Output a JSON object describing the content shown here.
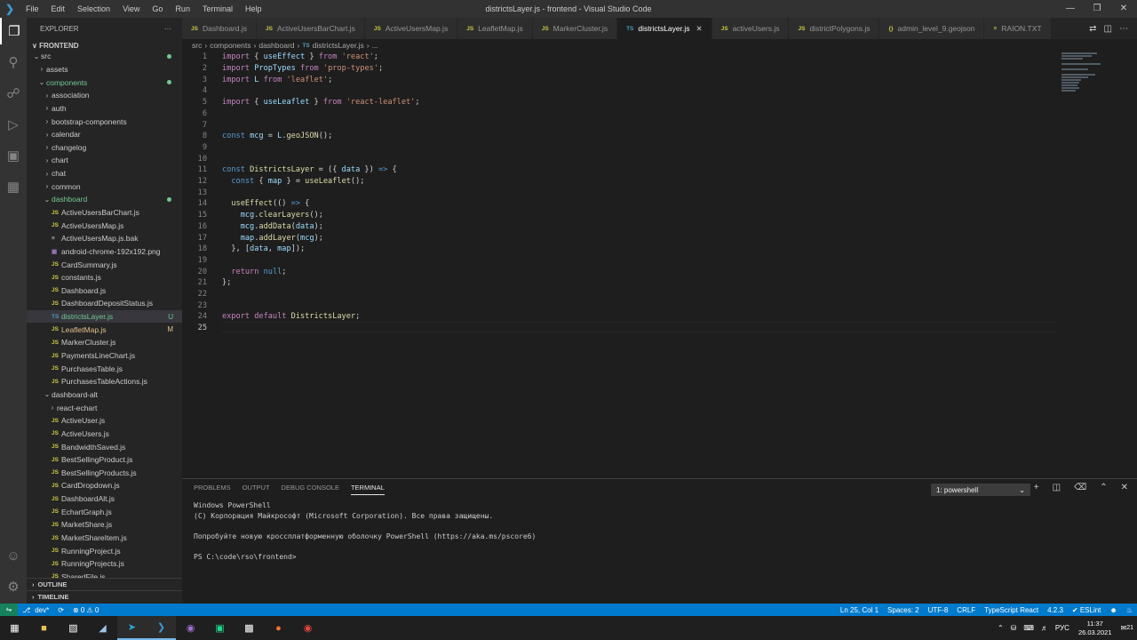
{
  "window": {
    "title": "districtsLayer.js - frontend - Visual Studio Code",
    "menus": [
      "File",
      "Edit",
      "Selection",
      "View",
      "Go",
      "Run",
      "Terminal",
      "Help"
    ]
  },
  "sidebar": {
    "header": "EXPLORER",
    "more": "···",
    "root": "FRONTEND",
    "items": [
      {
        "label": "src",
        "kind": "folder-open",
        "indent": 1,
        "status": "dot"
      },
      {
        "label": "assets",
        "kind": "folder",
        "indent": 2,
        "status": ""
      },
      {
        "label": "components",
        "kind": "folder-open",
        "indent": 2,
        "status": "dot",
        "color": "green"
      },
      {
        "label": "association",
        "kind": "folder",
        "indent": 3,
        "status": ""
      },
      {
        "label": "auth",
        "kind": "folder",
        "indent": 3,
        "status": ""
      },
      {
        "label": "bootstrap-components",
        "kind": "folder",
        "indent": 3,
        "status": ""
      },
      {
        "label": "calendar",
        "kind": "folder",
        "indent": 3,
        "status": ""
      },
      {
        "label": "changelog",
        "kind": "folder",
        "indent": 3,
        "status": ""
      },
      {
        "label": "chart",
        "kind": "folder",
        "indent": 3,
        "status": ""
      },
      {
        "label": "chat",
        "kind": "folder",
        "indent": 3,
        "status": ""
      },
      {
        "label": "common",
        "kind": "folder",
        "indent": 3,
        "status": ""
      },
      {
        "label": "dashboard",
        "kind": "folder-open",
        "indent": 3,
        "status": "dot",
        "color": "green"
      },
      {
        "label": "ActiveUsersBarChart.js",
        "kind": "js",
        "indent": 4,
        "status": ""
      },
      {
        "label": "ActiveUsersMap.js",
        "kind": "js",
        "indent": 4,
        "status": ""
      },
      {
        "label": "ActiveUsersMap.js.bak",
        "kind": "txt",
        "indent": 4,
        "status": ""
      },
      {
        "label": "android-chrome-192x192.png",
        "kind": "img",
        "indent": 4,
        "status": ""
      },
      {
        "label": "CardSummary.js",
        "kind": "js",
        "indent": 4,
        "status": ""
      },
      {
        "label": "constants.js",
        "kind": "js",
        "indent": 4,
        "status": ""
      },
      {
        "label": "Dashboard.js",
        "kind": "js",
        "indent": 4,
        "status": ""
      },
      {
        "label": "DashboardDepositStatus.js",
        "kind": "js",
        "indent": 4,
        "status": ""
      },
      {
        "label": "districtsLayer.js",
        "kind": "ts",
        "indent": 4,
        "status": "U",
        "color": "green",
        "selected": true
      },
      {
        "label": "LeafletMap.js",
        "kind": "js",
        "indent": 4,
        "status": "M",
        "color": "orange"
      },
      {
        "label": "MarkerCluster.js",
        "kind": "js",
        "indent": 4,
        "status": ""
      },
      {
        "label": "PaymentsLineChart.js",
        "kind": "js",
        "indent": 4,
        "status": ""
      },
      {
        "label": "PurchasesTable.js",
        "kind": "js",
        "indent": 4,
        "status": ""
      },
      {
        "label": "PurchasesTableActions.js",
        "kind": "js",
        "indent": 4,
        "status": ""
      },
      {
        "label": "dashboard-alt",
        "kind": "folder-open",
        "indent": 3,
        "status": ""
      },
      {
        "label": "react-echart",
        "kind": "folder",
        "indent": 4,
        "status": ""
      },
      {
        "label": "ActiveUser.js",
        "kind": "js",
        "indent": 4,
        "status": ""
      },
      {
        "label": "ActiveUsers.js",
        "kind": "js",
        "indent": 4,
        "status": ""
      },
      {
        "label": "BandwidthSaved.js",
        "kind": "js",
        "indent": 4,
        "status": ""
      },
      {
        "label": "BestSellingProduct.js",
        "kind": "js",
        "indent": 4,
        "status": ""
      },
      {
        "label": "BestSellingProducts.js",
        "kind": "js",
        "indent": 4,
        "status": ""
      },
      {
        "label": "CardDropdown.js",
        "kind": "js",
        "indent": 4,
        "status": ""
      },
      {
        "label": "DashboardAlt.js",
        "kind": "js",
        "indent": 4,
        "status": ""
      },
      {
        "label": "EchartGraph.js",
        "kind": "js",
        "indent": 4,
        "status": ""
      },
      {
        "label": "MarketShare.js",
        "kind": "js",
        "indent": 4,
        "status": ""
      },
      {
        "label": "MarketShareItem.js",
        "kind": "js",
        "indent": 4,
        "status": ""
      },
      {
        "label": "RunningProject.js",
        "kind": "js",
        "indent": 4,
        "status": ""
      },
      {
        "label": "RunningProjects.js",
        "kind": "js",
        "indent": 4,
        "status": ""
      },
      {
        "label": "SharedFile.js",
        "kind": "js",
        "indent": 4,
        "status": ""
      }
    ],
    "outline": "OUTLINE",
    "timeline": "TIMELINE"
  },
  "tabs": [
    {
      "label": "Dashboard.js",
      "icon": "JS",
      "active": false
    },
    {
      "label": "ActiveUsersBarChart.js",
      "icon": "JS",
      "active": false
    },
    {
      "label": "ActiveUsersMap.js",
      "icon": "JS",
      "active": false
    },
    {
      "label": "LeafletMap.js",
      "icon": "JS",
      "active": false
    },
    {
      "label": "MarkerCluster.js",
      "icon": "JS",
      "active": false
    },
    {
      "label": "districtsLayer.js",
      "icon": "TS",
      "active": true
    },
    {
      "label": "activeUsers.js",
      "icon": "JS",
      "active": false
    },
    {
      "label": "districtPolygons.js",
      "icon": "JS",
      "active": false
    },
    {
      "label": "admin_level_9.geojson",
      "icon": "{}",
      "active": false
    },
    {
      "label": "RAION.TXT",
      "icon": "≡",
      "active": false
    }
  ],
  "breadcrumb": [
    "src",
    "components",
    "dashboard",
    "districtsLayer.js",
    "..."
  ],
  "breadcrumb_ts": "TS",
  "editor": {
    "lines": [
      {
        "n": "1",
        "t": [
          [
            "k",
            "import"
          ],
          [
            "p",
            " { "
          ],
          [
            "v",
            "useEffect"
          ],
          [
            "p",
            " } "
          ],
          [
            "k",
            "from"
          ],
          [
            "p",
            " "
          ],
          [
            "s",
            "'react'"
          ],
          [
            "p",
            ";"
          ]
        ]
      },
      {
        "n": "2",
        "t": [
          [
            "k",
            "import"
          ],
          [
            "p",
            " "
          ],
          [
            "v",
            "PropTypes"
          ],
          [
            "p",
            " "
          ],
          [
            "k",
            "from"
          ],
          [
            "p",
            " "
          ],
          [
            "s",
            "'prop-types'"
          ],
          [
            "p",
            ";"
          ]
        ]
      },
      {
        "n": "3",
        "t": [
          [
            "k",
            "import"
          ],
          [
            "p",
            " "
          ],
          [
            "v",
            "L"
          ],
          [
            "p",
            " "
          ],
          [
            "k",
            "from"
          ],
          [
            "p",
            " "
          ],
          [
            "s",
            "'leaflet'"
          ],
          [
            "p",
            ";"
          ]
        ]
      },
      {
        "n": "4",
        "t": []
      },
      {
        "n": "5",
        "t": [
          [
            "k",
            "import"
          ],
          [
            "p",
            " { "
          ],
          [
            "v",
            "useLeaflet"
          ],
          [
            "p",
            " } "
          ],
          [
            "k",
            "from"
          ],
          [
            "p",
            " "
          ],
          [
            "s",
            "'react-leaflet'"
          ],
          [
            "p",
            ";"
          ]
        ]
      },
      {
        "n": "6",
        "t": []
      },
      {
        "n": "7",
        "t": []
      },
      {
        "n": "8",
        "t": [
          [
            "b",
            "const"
          ],
          [
            "p",
            " "
          ],
          [
            "v",
            "mcg"
          ],
          [
            "p",
            " = "
          ],
          [
            "v",
            "L"
          ],
          [
            "p",
            "."
          ],
          [
            "f",
            "geoJSON"
          ],
          [
            "p",
            "();"
          ]
        ]
      },
      {
        "n": "9",
        "t": []
      },
      {
        "n": "10",
        "t": []
      },
      {
        "n": "11",
        "t": [
          [
            "b",
            "const"
          ],
          [
            "p",
            " "
          ],
          [
            "f",
            "DistrictsLayer"
          ],
          [
            "p",
            " = ({ "
          ],
          [
            "v",
            "data"
          ],
          [
            "p",
            " }) "
          ],
          [
            "b",
            "=>"
          ],
          [
            "p",
            " {"
          ]
        ]
      },
      {
        "n": "12",
        "t": [
          [
            "p",
            "  "
          ],
          [
            "b",
            "const"
          ],
          [
            "p",
            " { "
          ],
          [
            "v",
            "map"
          ],
          [
            "p",
            " } = "
          ],
          [
            "f",
            "useLeaflet"
          ],
          [
            "p",
            "();"
          ]
        ]
      },
      {
        "n": "13",
        "t": []
      },
      {
        "n": "14",
        "t": [
          [
            "p",
            "  "
          ],
          [
            "f",
            "useEffect"
          ],
          [
            "p",
            "(() "
          ],
          [
            "b",
            "=>"
          ],
          [
            "p",
            " {"
          ]
        ]
      },
      {
        "n": "15",
        "t": [
          [
            "p",
            "    "
          ],
          [
            "v",
            "mcg"
          ],
          [
            "p",
            "."
          ],
          [
            "f",
            "clearLayers"
          ],
          [
            "p",
            "();"
          ]
        ]
      },
      {
        "n": "16",
        "t": [
          [
            "p",
            "    "
          ],
          [
            "v",
            "mcg"
          ],
          [
            "p",
            "."
          ],
          [
            "f",
            "addData"
          ],
          [
            "p",
            "("
          ],
          [
            "v",
            "data"
          ],
          [
            "p",
            ");"
          ]
        ]
      },
      {
        "n": "17",
        "t": [
          [
            "p",
            "    "
          ],
          [
            "v",
            "map"
          ],
          [
            "p",
            "."
          ],
          [
            "f",
            "addLayer"
          ],
          [
            "p",
            "("
          ],
          [
            "v",
            "mcg"
          ],
          [
            "p",
            ");"
          ]
        ]
      },
      {
        "n": "18",
        "t": [
          [
            "p",
            "  }, ["
          ],
          [
            "v",
            "data"
          ],
          [
            "p",
            ", "
          ],
          [
            "v",
            "map"
          ],
          [
            "p",
            "]);"
          ]
        ]
      },
      {
        "n": "19",
        "t": []
      },
      {
        "n": "20",
        "t": [
          [
            "p",
            "  "
          ],
          [
            "k",
            "return"
          ],
          [
            "p",
            " "
          ],
          [
            "b",
            "null"
          ],
          [
            "p",
            ";"
          ]
        ]
      },
      {
        "n": "21",
        "t": [
          [
            "p",
            "};"
          ]
        ]
      },
      {
        "n": "22",
        "t": []
      },
      {
        "n": "23",
        "t": []
      },
      {
        "n": "24",
        "t": [
          [
            "k",
            "export"
          ],
          [
            "p",
            " "
          ],
          [
            "k",
            "default"
          ],
          [
            "p",
            " "
          ],
          [
            "f",
            "DistrictsLayer"
          ],
          [
            "p",
            ";"
          ]
        ]
      },
      {
        "n": "25",
        "t": []
      }
    ]
  },
  "panel": {
    "tabs": [
      "PROBLEMS",
      "OUTPUT",
      "DEBUG CONSOLE",
      "TERMINAL"
    ],
    "active_tab": "TERMINAL",
    "terminal_select": "1: powershell",
    "terminal_lines": [
      "Windows PowerShell",
      "(C) Корпорация Майкрософт (Microsoft Corporation). Все права защищены.",
      "",
      "Попробуйте новую кроссплатформенную оболочку PowerShell (https://aka.ms/pscore6)",
      "",
      "PS C:\\code\\rso\\frontend>"
    ]
  },
  "statusbar": {
    "branch": "dev*",
    "sync": "⟳",
    "errors": "⊗ 0 ⚠ 0",
    "position": "Ln 25, Col 1",
    "spaces": "Spaces: 2",
    "encoding": "UTF-8",
    "eol": "CRLF",
    "language": "TypeScript React",
    "version": "4.2.3",
    "eslint": "✔ ESLint"
  },
  "taskbar": {
    "lang": "РУС",
    "time": "11:37",
    "date": "26.03.2021",
    "notifications": "21"
  },
  "colors": {
    "accent": "#007acc",
    "titlebar": "#323233",
    "sidebar": "#252526",
    "editor": "#1e1e1e"
  }
}
